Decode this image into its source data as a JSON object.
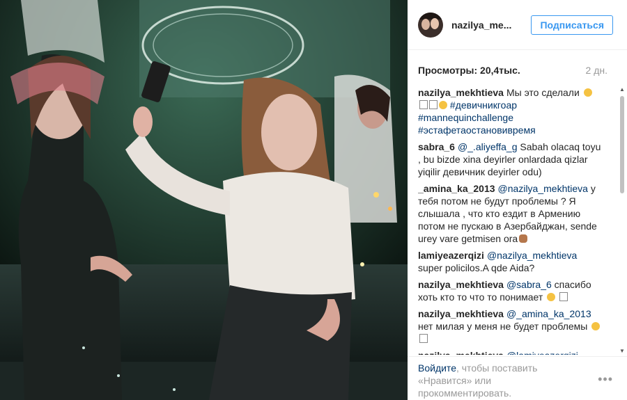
{
  "post": {
    "username": "nazilya_me...",
    "follow_label": "Подписаться",
    "views": "Просмотры: 20,4тыс.",
    "time": "2 дн."
  },
  "comments": [
    {
      "user": "nazilya_mekhtieva",
      "parts": [
        {
          "t": "text",
          "v": "Мы это сделали "
        },
        {
          "t": "emoji",
          "icon": "grinning-face-emoji"
        },
        {
          "t": "text",
          "v": " "
        },
        {
          "t": "emoji",
          "icon": "unsupported-glyph-box"
        },
        {
          "t": "emoji",
          "icon": "unsupported-glyph-box"
        },
        {
          "t": "emoji",
          "icon": "tongue-face-emoji"
        },
        {
          "t": "text",
          "v": " "
        },
        {
          "t": "tag",
          "v": "#девичникгоар"
        },
        {
          "t": "text",
          "v": " "
        },
        {
          "t": "tag",
          "v": "#mannequinchallenge"
        },
        {
          "t": "text",
          "v": " "
        },
        {
          "t": "tag",
          "v": "#эстафетаостановивремя"
        }
      ]
    },
    {
      "user": "sabra_6",
      "parts": [
        {
          "t": "mention",
          "v": "@_.aliyeffa_g"
        },
        {
          "t": "text",
          "v": " Sabah olacaq toyu , bu bizde xina deyirler onlardada qizlar yiqilir девичник deyirler odu)"
        }
      ]
    },
    {
      "user": "_amina_ka_2013",
      "parts": [
        {
          "t": "mention",
          "v": "@nazilya_mekhtieva"
        },
        {
          "t": "text",
          "v": " у тебя потом не будут проблемы ? Я слышала , что кто ездит в Армению потом не пускаю в Азербайджан, sende urey vare getmisen ora"
        },
        {
          "t": "emoji",
          "icon": "monkey-face-emoji"
        }
      ]
    },
    {
      "user": "lamiyeazerqizi",
      "parts": [
        {
          "t": "mention",
          "v": "@nazilya_mekhtieva"
        },
        {
          "t": "text",
          "v": " super policilos.A qde Aida?"
        }
      ]
    },
    {
      "user": "nazilya_mekhtieva",
      "parts": [
        {
          "t": "mention",
          "v": "@sabra_6"
        },
        {
          "t": "text",
          "v": " спасибо хоть кто то что то понимает "
        },
        {
          "t": "emoji",
          "icon": "astonished-face-emoji"
        },
        {
          "t": "text",
          "v": " "
        },
        {
          "t": "emoji",
          "icon": "unsupported-glyph-box"
        }
      ]
    },
    {
      "user": "nazilya_mekhtieva",
      "parts": [
        {
          "t": "mention",
          "v": "@_amina_ka_2013"
        },
        {
          "t": "text",
          "v": " нет милая у меня не будет проблемы "
        },
        {
          "t": "emoji",
          "icon": "astonished-face-emoji"
        },
        {
          "t": "text",
          "v": " "
        },
        {
          "t": "emoji",
          "icon": "unsupported-glyph-box"
        }
      ]
    },
    {
      "user": "nazilya_mekhtieva",
      "parts": [
        {
          "t": "mention",
          "v": "@lamiyeazerqizi"
        }
      ]
    }
  ],
  "footer": {
    "login_link": "Войдите",
    "text": ", чтобы поставить «Нравится» или прокомментировать.",
    "more_label": "•••"
  },
  "colors": {
    "link": "#003569",
    "follow": "#3897f0",
    "muted": "#999999"
  }
}
